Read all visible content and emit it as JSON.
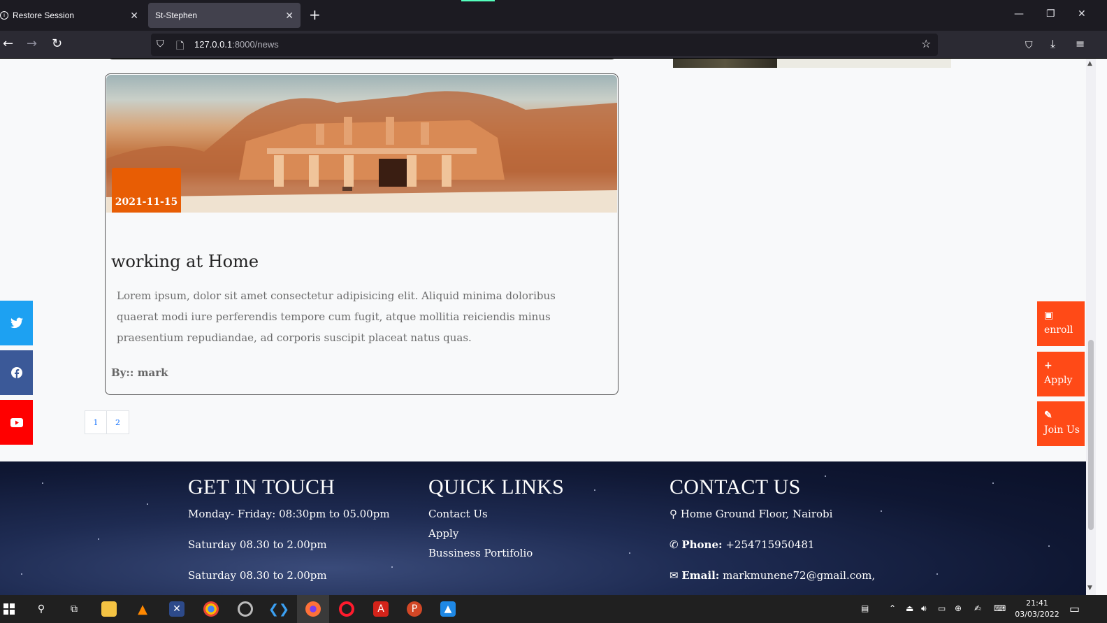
{
  "browser": {
    "tabs": [
      {
        "label": "Restore Session",
        "active": false
      },
      {
        "label": "St-Stephen",
        "active": true
      }
    ],
    "url_host": "127.0.0.1",
    "url_rest": ":8000/news"
  },
  "news_card": {
    "date": "2021-11-15",
    "title": "working at Home",
    "body": "Lorem ipsum, dolor sit amet consectetur adipisicing elit. Aliquid minima doloribus quaerat modi iure perferendis tempore cum fugit, atque mollitia reiciendis minus praesentium repudiandae, ad corporis suscipit placeat natus quas.",
    "author": "By:: mark"
  },
  "pagination": [
    "1",
    "2"
  ],
  "social_links": [
    {
      "name": "twitter-icon",
      "color": "#1da1f2"
    },
    {
      "name": "facebook-icon",
      "color": "#3b5998"
    },
    {
      "name": "youtube-icon",
      "color": "#ff0000"
    }
  ],
  "side_actions": [
    {
      "label": "enroll",
      "icon": "id-card-icon"
    },
    {
      "label": "Apply",
      "icon": "plus-icon"
    },
    {
      "label": "Join Us",
      "icon": "signature-icon"
    }
  ],
  "footer": {
    "get_in_touch": {
      "heading": "GET IN TOUCH",
      "lines": [
        "Monday- Friday: 08:30pm to 05.00pm",
        "Saturday 08.30 to 2.00pm",
        "Saturday 08.30 to 2.00pm"
      ]
    },
    "quick_links": {
      "heading": "QUICK LINKS",
      "links": [
        "Contact Us",
        "Apply",
        "Bussiness Portifolio"
      ]
    },
    "contact_us": {
      "heading": "CONTACT US",
      "address": "Home Ground Floor, Nairobi",
      "phone_label": "Phone:",
      "phone": "+254715950481",
      "email_label": "Email:",
      "email": "markmunene72@gmail.com,"
    }
  },
  "taskbar": {
    "time": "21:41",
    "date": "03/03/2022"
  },
  "colors": {
    "accent_orange": "#e85d04",
    "side_action_orange": "#ff4a17",
    "footer_bg": "#1e2b52"
  }
}
